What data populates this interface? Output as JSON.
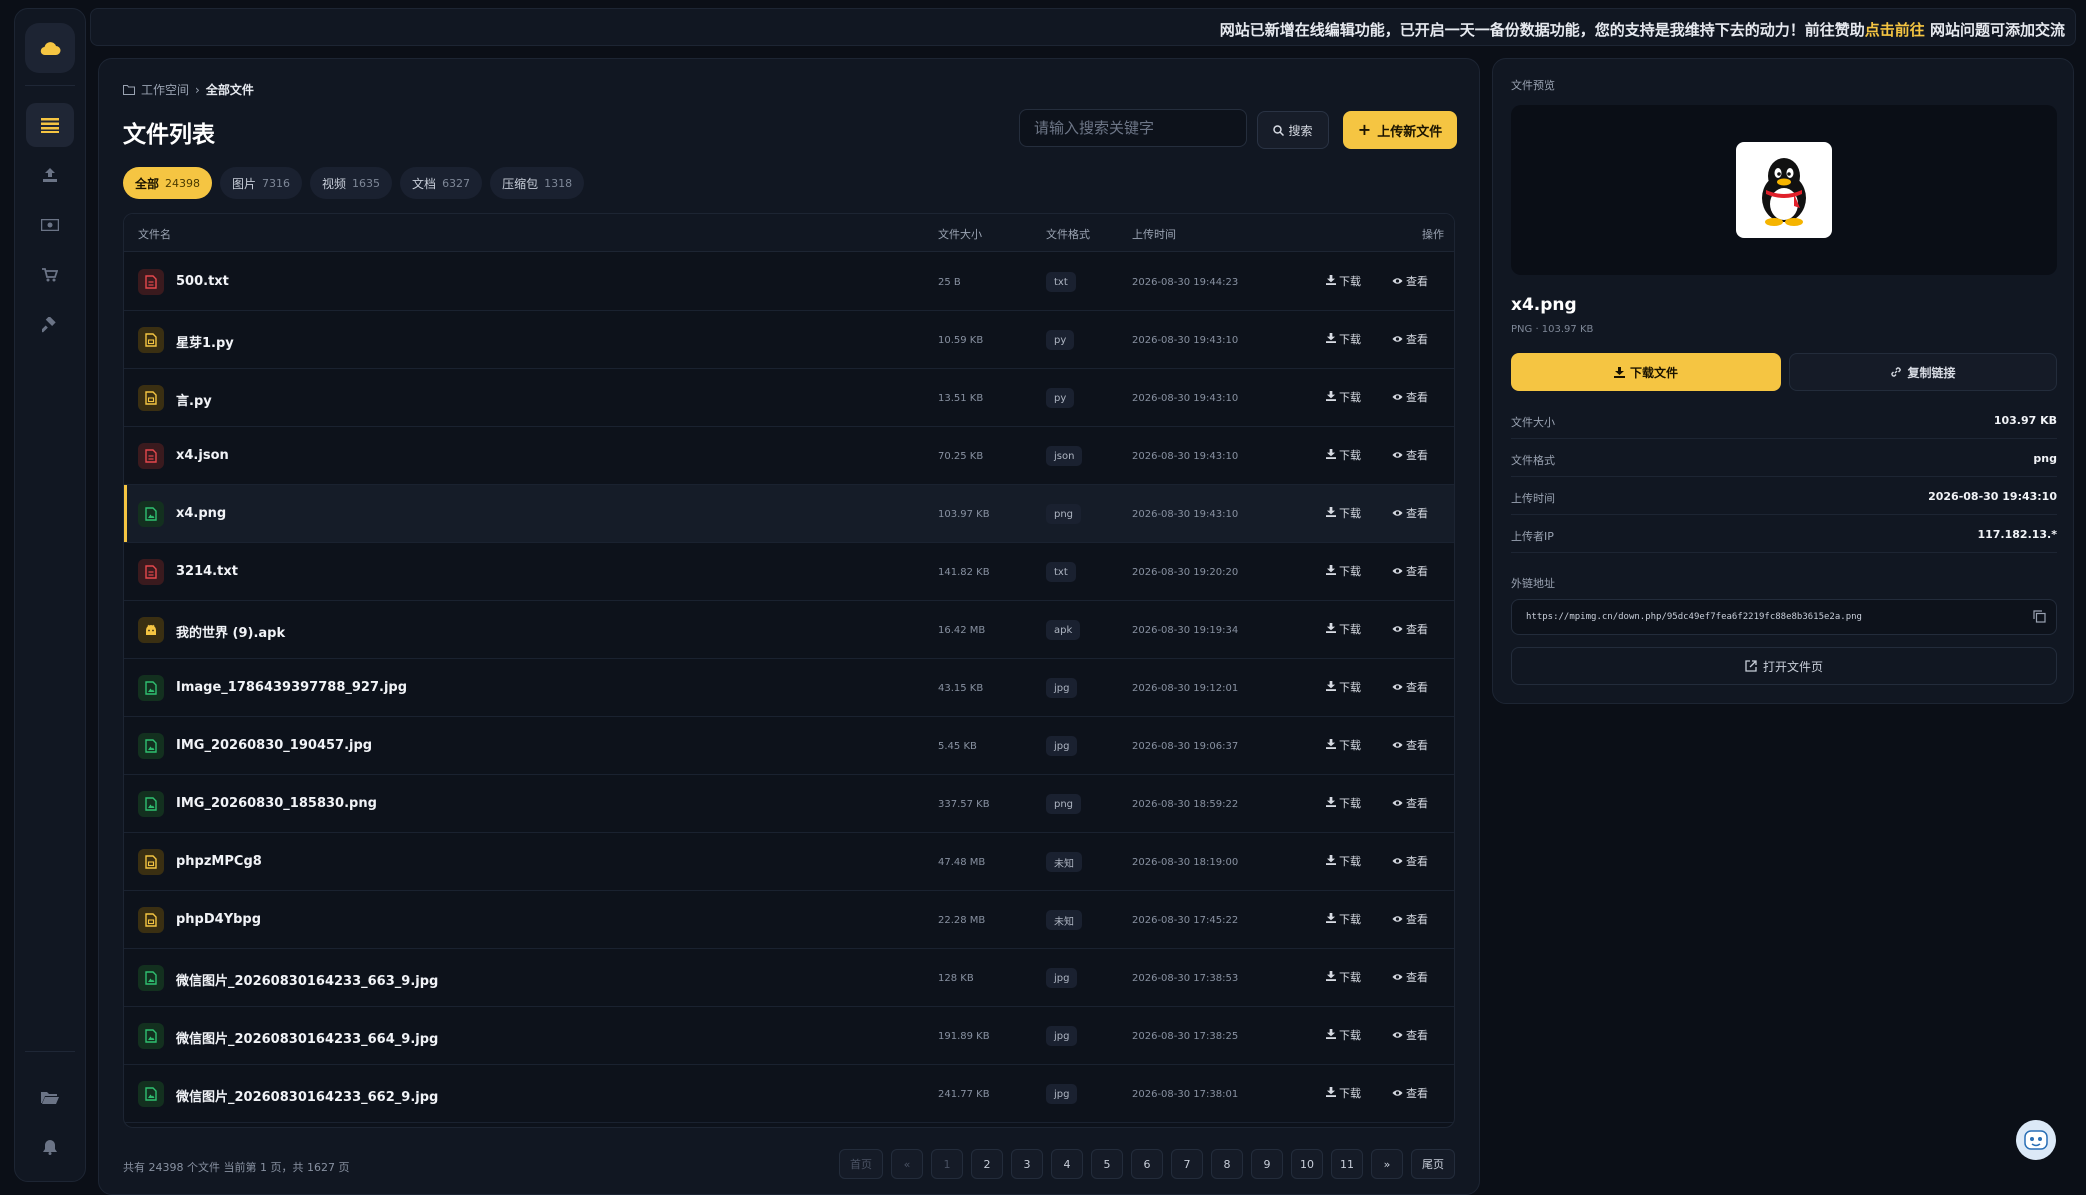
{
  "notice": {
    "text_before": "网站已新增在线编辑功能，已开启一天一备份数据功能，您的支持是我维持下去的动力！前往赞助",
    "link": "点击前往",
    "text_after": " 网站问题可添加交流"
  },
  "breadcrumb": {
    "root": "工作空间",
    "current": "全部文件"
  },
  "title": "文件列表",
  "search": {
    "placeholder": "请输入搜索关键字",
    "button": "搜索"
  },
  "upload_button": "上传新文件",
  "chips": [
    {
      "label": "全部",
      "count": "24398"
    },
    {
      "label": "图片",
      "count": "7316"
    },
    {
      "label": "视频",
      "count": "1635"
    },
    {
      "label": "文档",
      "count": "6327"
    },
    {
      "label": "压缩包",
      "count": "1318"
    }
  ],
  "columns": {
    "name": "文件名",
    "size": "文件大小",
    "format": "文件格式",
    "time": "上传时间",
    "action": "操作"
  },
  "actions": {
    "download": "下载",
    "view": "查看"
  },
  "files": [
    {
      "name": "500.txt",
      "size": "25 B",
      "format": "txt",
      "time": "2026-08-30 19:44:23",
      "icon": "red"
    },
    {
      "name": "星芽1.py",
      "size": "10.59 KB",
      "format": "py",
      "time": "2026-08-30 19:43:10",
      "icon": "yel"
    },
    {
      "name": "言.py",
      "size": "13.51 KB",
      "format": "py",
      "time": "2026-08-30 19:43:10",
      "icon": "yel"
    },
    {
      "name": "x4.json",
      "size": "70.25 KB",
      "format": "json",
      "time": "2026-08-30 19:43:10",
      "icon": "red"
    },
    {
      "name": "x4.png",
      "size": "103.97 KB",
      "format": "png",
      "time": "2026-08-30 19:43:10",
      "icon": "grn"
    },
    {
      "name": "3214.txt",
      "size": "141.82 KB",
      "format": "txt",
      "time": "2026-08-30 19:20:20",
      "icon": "red"
    },
    {
      "name": "我的世界 (9).apk",
      "size": "16.42 MB",
      "format": "apk",
      "time": "2026-08-30 19:19:34",
      "icon": "apk"
    },
    {
      "name": "Image_1786439397788_927.jpg",
      "size": "43.15 KB",
      "format": "jpg",
      "time": "2026-08-30 19:12:01",
      "icon": "grn"
    },
    {
      "name": "IMG_20260830_190457.jpg",
      "size": "5.45 KB",
      "format": "jpg",
      "time": "2026-08-30 19:06:37",
      "icon": "grn"
    },
    {
      "name": "IMG_20260830_185830.png",
      "size": "337.57 KB",
      "format": "png",
      "time": "2026-08-30 18:59:22",
      "icon": "grn"
    },
    {
      "name": "phpzMPCg8",
      "size": "47.48 MB",
      "format": "未知",
      "time": "2026-08-30 18:19:00",
      "icon": "yel"
    },
    {
      "name": "phpD4Ybpg",
      "size": "22.28 MB",
      "format": "未知",
      "time": "2026-08-30 17:45:22",
      "icon": "yel"
    },
    {
      "name": "微信图片_20260830164233_663_9.jpg",
      "size": "128 KB",
      "format": "jpg",
      "time": "2026-08-30 17:38:53",
      "icon": "grn"
    },
    {
      "name": "微信图片_20260830164233_664_9.jpg",
      "size": "191.89 KB",
      "format": "jpg",
      "time": "2026-08-30 17:38:25",
      "icon": "grn"
    },
    {
      "name": "微信图片_20260830164233_662_9.jpg",
      "size": "241.77 KB",
      "format": "jpg",
      "time": "2026-08-30 17:38:01",
      "icon": "grn"
    }
  ],
  "selected_index": 4,
  "footer_info": "共有 24398 个文件  当前第 1 页，共 1627 页",
  "pager": {
    "first": "首页",
    "prev": "«",
    "pages": [
      "1",
      "2",
      "3",
      "4",
      "5",
      "6",
      "7",
      "8",
      "9",
      "10",
      "11"
    ],
    "next": "»",
    "last": "尾页"
  },
  "preview": {
    "label": "文件预览",
    "name": "x4.png",
    "meta": "PNG · 103.97 KB",
    "download": "下载文件",
    "copy": "复制链接",
    "rows": [
      {
        "k": "文件大小",
        "v": "103.97 KB"
      },
      {
        "k": "文件格式",
        "v": "png"
      },
      {
        "k": "上传时间",
        "v": "2026-08-30 19:43:10"
      },
      {
        "k": "上传者IP",
        "v": "117.182.13.*"
      }
    ],
    "url_label": "外链地址",
    "url": "https://mpimg.cn/down.php/95dc49ef7fea6f2219fc88e8b3615e2a.png",
    "open": "打开文件页"
  },
  "colors": {
    "accent": "#f5c542",
    "bg": "#0b0f17",
    "panel": "#111722"
  }
}
